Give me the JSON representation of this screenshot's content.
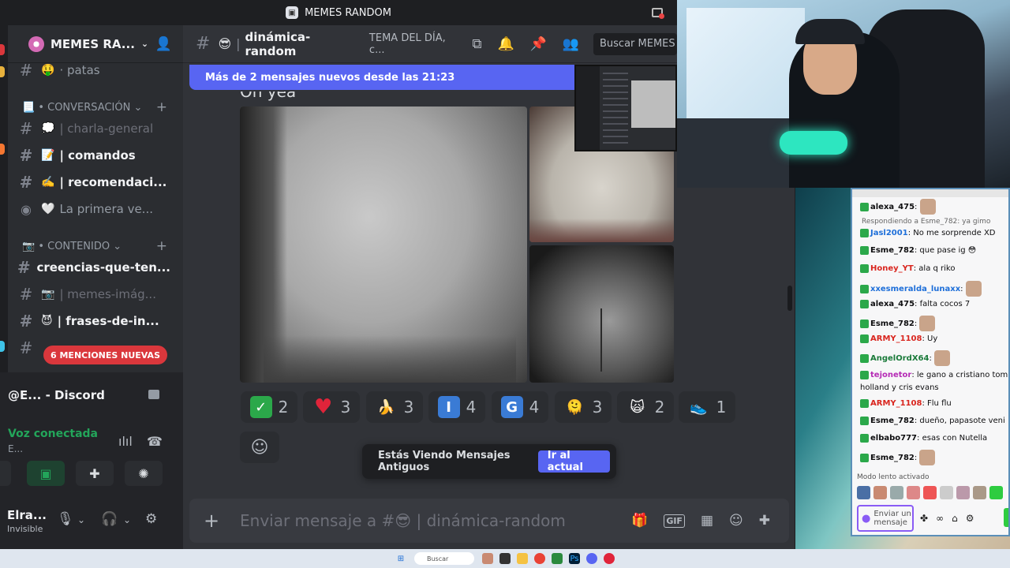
{
  "window": {
    "title": "MEMES RANDOM"
  },
  "server": {
    "name": "MEMES RA..."
  },
  "sidebar": {
    "channels": [
      {
        "emoji": "🤑",
        "label": "· patas",
        "style": "normal"
      },
      {
        "emoji": "💭",
        "label": "| charla-general",
        "style": "muted"
      },
      {
        "emoji": "📝",
        "label": "| comandos",
        "style": "bold"
      },
      {
        "emoji": "✍️",
        "label": "| recomendaci...",
        "style": "bold"
      },
      {
        "emoji": "🤍",
        "label": "La primera ve...",
        "style": "normal"
      },
      {
        "emoji": "",
        "label": "creencias-que-ten...",
        "style": "bold"
      },
      {
        "emoji": "📷",
        "label": "| memes-imág...",
        "style": "muted"
      },
      {
        "emoji": "😈",
        "label": "| frases-de-in...",
        "style": "bold"
      }
    ],
    "categories": [
      {
        "label": "📃 • CONVERSACIÓN ⌄"
      },
      {
        "label": "📷 • CONTENIDO ⌄"
      }
    ],
    "mentions_badge": "6 MENCIONES NUEVAS"
  },
  "voice": {
    "title": "@E... - Discord",
    "status": "Voz conectada",
    "sub": "E..."
  },
  "user": {
    "name": "Elra...",
    "status": "Invisible"
  },
  "header": {
    "emoji": "😎",
    "channel": "dinámica-random",
    "topic": "TEMA DEL DÍA, c...",
    "search": "Buscar MEMES R"
  },
  "messages": {
    "new_bar": "Más de 2 mensajes nuevos desde las 21:23",
    "text": "Oh yea"
  },
  "reactions": [
    {
      "icon": "✓",
      "count": "2",
      "color": "#2ba84a"
    },
    {
      "icon": "♥",
      "count": "3",
      "color": ""
    },
    {
      "icon": "🍌",
      "count": "3",
      "color": ""
    },
    {
      "icon": "I",
      "count": "4",
      "color": "#3a7bd5"
    },
    {
      "icon": "G",
      "count": "4",
      "color": "#3a7bd5"
    },
    {
      "icon": "🫠",
      "count": "3",
      "color": ""
    },
    {
      "icon": "🙀",
      "count": "2",
      "color": ""
    },
    {
      "icon": "👟",
      "count": "1",
      "color": ""
    }
  ],
  "jump": {
    "text": "Estás Viendo Mensajes Antiguos",
    "button": "Ir al actual"
  },
  "composer": {
    "placeholder_prefix": "Enviar mensaje a #",
    "placeholder_emoji": "😎",
    "placeholder_channel": "| dinámica-random"
  },
  "chat": {
    "lines": [
      {
        "user": "alexa_475",
        "text": "",
        "color": "#0e0e10",
        "emote": true
      },
      {
        "user": "",
        "text": "Respondiendo a Esme_782: ya gimo",
        "reply": true
      },
      {
        "user": "Jasl2001",
        "text": "No me sorprende XD",
        "color": "#1e6fd9"
      },
      {
        "user": "Esme_782",
        "text": "que pase ig 😳",
        "color": "#0e0e10"
      },
      {
        "user": "Honey_YT",
        "text": "ala q riko",
        "color": "#d9251e"
      },
      {
        "user": "xxesmeralda_lunaxx",
        "text": "",
        "color": "#1e6fd9",
        "emote": true
      },
      {
        "user": "alexa_475",
        "text": "falta cocos 7",
        "color": "#0e0e10"
      },
      {
        "user": "Esme_782",
        "text": "",
        "color": "#0e0e10",
        "emote": true
      },
      {
        "user": "ARMY_1108",
        "text": "Uy",
        "color": "#d9251e"
      },
      {
        "user": "AngelOrdX64",
        "text": "",
        "color": "#1a7a3a",
        "emote": true
      },
      {
        "user": "tejonetor",
        "text": "le gano a cristiano tom holland y cris evans",
        "color": "#b52bb5"
      },
      {
        "user": "ARMY_1108",
        "text": "Flu flu",
        "color": "#d9251e"
      },
      {
        "user": "Esme_782",
        "text": "dueño, papasote veni",
        "color": "#0e0e10"
      },
      {
        "user": "elbabo777",
        "text": "esas con Nutella",
        "color": "#0e0e10"
      },
      {
        "user": "Esme_782",
        "text": "",
        "color": "#0e0e10",
        "emote": true
      }
    ],
    "slow_mode": "Modo lento activado",
    "input_placeholder": "Enviar un mensaje"
  },
  "taskbar": {
    "search": "Buscar"
  }
}
